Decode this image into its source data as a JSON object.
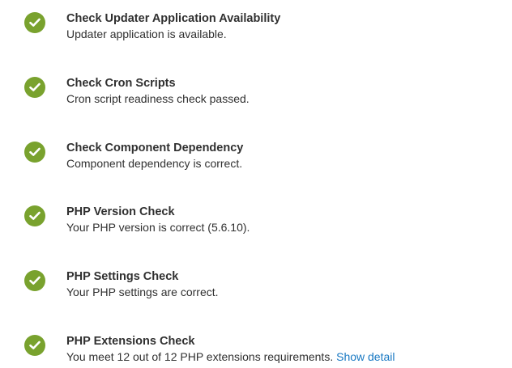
{
  "colors": {
    "success": "#79a22e",
    "text": "#303030",
    "link": "#1979c3"
  },
  "checks": [
    {
      "icon": "check-circle-icon",
      "title": "Check Updater Application Availability",
      "description": "Updater application is available."
    },
    {
      "icon": "check-circle-icon",
      "title": "Check Cron Scripts",
      "description": "Cron script readiness check passed."
    },
    {
      "icon": "check-circle-icon",
      "title": "Check Component Dependency",
      "description": "Component dependency is correct."
    },
    {
      "icon": "check-circle-icon",
      "title": "PHP Version Check",
      "description": "Your PHP version is correct (5.6.10)."
    },
    {
      "icon": "check-circle-icon",
      "title": "PHP Settings Check",
      "description": "Your PHP settings are correct."
    },
    {
      "icon": "check-circle-icon",
      "title": "PHP Extensions Check",
      "description": "You meet 12 out of 12 PHP extensions requirements.",
      "link_label": "Show detail"
    }
  ]
}
